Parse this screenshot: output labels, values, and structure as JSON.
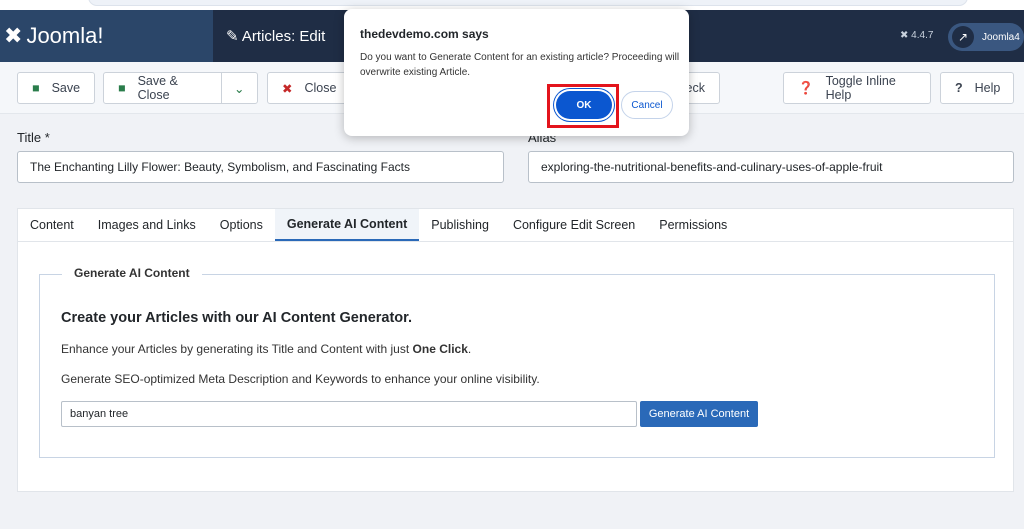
{
  "header": {
    "logo": "Joomla!",
    "page_title": "Articles: Edit",
    "version": "4.4.7",
    "user": "Joomla4"
  },
  "toolbar": {
    "save": "Save",
    "save_close": "Save & Close",
    "close": "Close",
    "check": "heck",
    "toggle_help": "Toggle Inline Help",
    "help": "Help"
  },
  "form": {
    "title_label": "Title *",
    "title_value": "The Enchanting Lilly Flower: Beauty, Symbolism, and Fascinating Facts",
    "alias_label": "Alias",
    "alias_value": "exploring-the-nutritional-benefits-and-culinary-uses-of-apple-fruit"
  },
  "tabs": [
    "Content",
    "Images and Links",
    "Options",
    "Generate AI Content",
    "Publishing",
    "Configure Edit Screen",
    "Permissions"
  ],
  "active_tab": "Generate AI Content",
  "ai": {
    "legend": "Generate AI Content",
    "heading": "Create your Articles with our AI Content Generator.",
    "line1_pre": "Enhance your Articles by generating its Title and Content with just ",
    "line1_bold": "One Click",
    "line1_post": ".",
    "line2": "Generate SEO-optimized Meta Description and Keywords to enhance your online visibility.",
    "keyword_value": "banyan tree",
    "button": "Generate AI Content"
  },
  "dialog": {
    "title": "thedevdemo.com says",
    "message": "Do you want to Generate Content for an existing article? Proceeding will overwrite existing Article.",
    "ok": "OK",
    "cancel": "Cancel",
    "highlight_color": "#e3141c"
  }
}
